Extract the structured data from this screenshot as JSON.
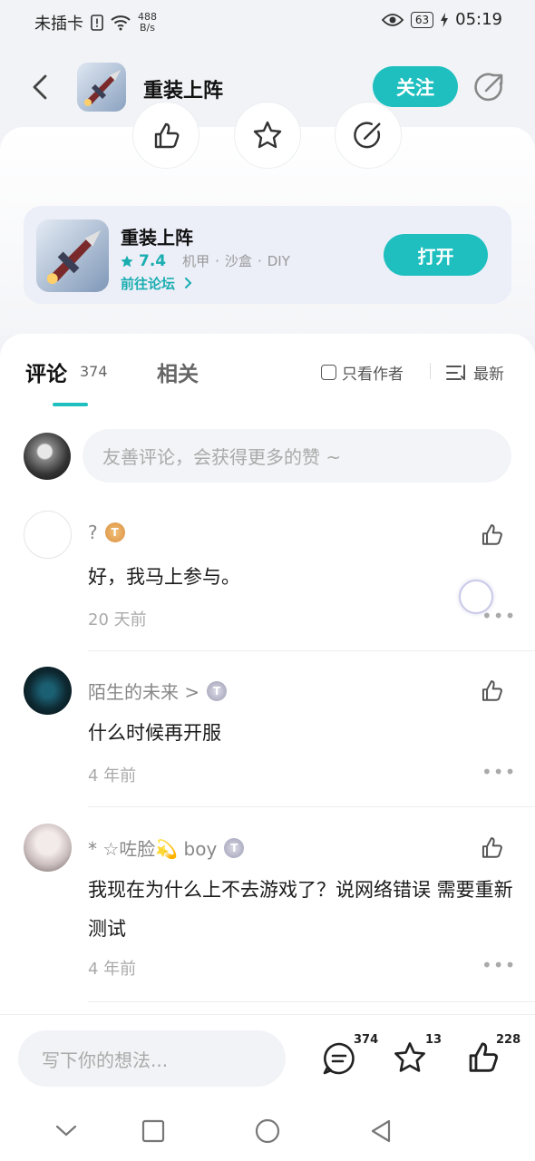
{
  "status_bar": {
    "carrier": "未插卡",
    "net_speed_value": "488",
    "net_speed_unit": "B/s",
    "battery": "63",
    "time": "05:19",
    "icons": [
      "sim-alert-icon",
      "wifi-icon",
      "eye-icon",
      "battery-icon",
      "charging-icon"
    ]
  },
  "header": {
    "title": "重装上阵",
    "follow_label": "关注"
  },
  "game_card": {
    "name": "重装上阵",
    "score": "7.4",
    "tags": [
      "机甲",
      "沙盒",
      "DIY"
    ],
    "forum_link": "前往论坛",
    "open_label": "打开"
  },
  "tabs": {
    "comments_label": "评论",
    "comments_count": "374",
    "related_label": "相关",
    "author_only_label": "只看作者",
    "sort_label": "最新"
  },
  "comment_input": {
    "placeholder": "友善评论，会获得更多的赞 ~"
  },
  "comments": [
    {
      "name": "?",
      "badge": "T",
      "text": "好，我马上参与。",
      "time": "20 天前",
      "more": "•••"
    },
    {
      "name": "陌生的未来 >",
      "badge": "T",
      "text": "什么时候再开服",
      "time": "4 年前",
      "more": "•••"
    },
    {
      "name": "* ☆咗脸💫  boy",
      "badge": "T",
      "text": "我现在为什么上不去游戏了？说网络错误 需要重新测试",
      "time": "4 年前",
      "more": "•••"
    }
  ],
  "bottom_bar": {
    "write_placeholder": "写下你的想法...",
    "comments_count": "374",
    "favorites_count": "13",
    "likes_count": "228"
  },
  "colors": {
    "accent": "#1fbfbf",
    "accent_text": "#1aaeb0"
  }
}
